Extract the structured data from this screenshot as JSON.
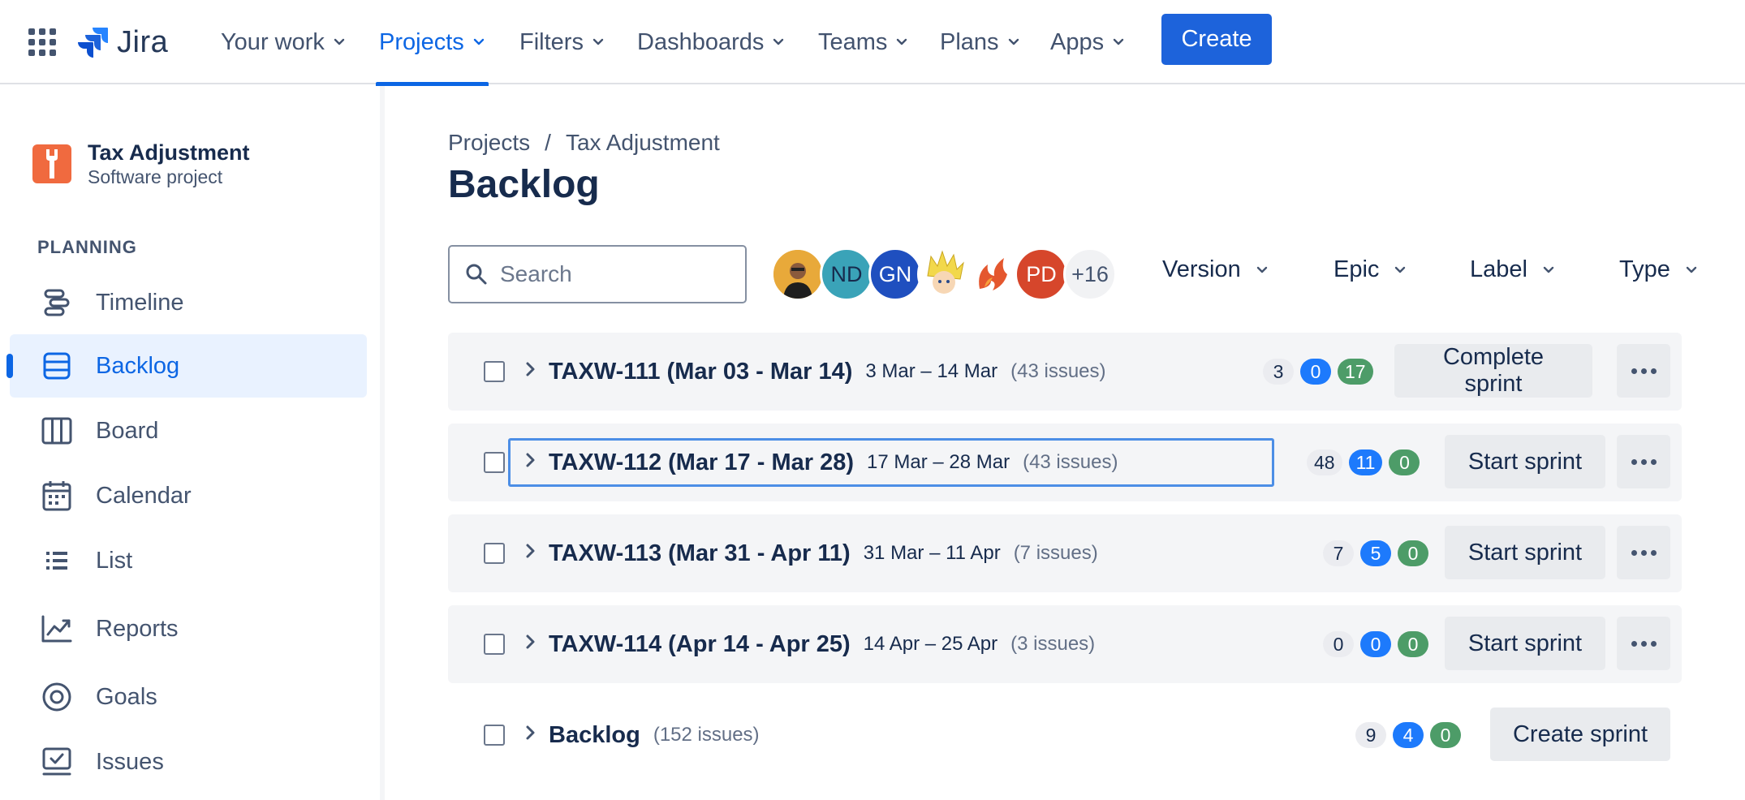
{
  "topnav": {
    "logo_text": "Jira",
    "items": [
      {
        "label": "Your work"
      },
      {
        "label": "Projects",
        "active": true
      },
      {
        "label": "Filters"
      },
      {
        "label": "Dashboards"
      },
      {
        "label": "Teams"
      },
      {
        "label": "Plans"
      },
      {
        "label": "Apps"
      }
    ],
    "create_label": "Create"
  },
  "sidebar": {
    "project_name": "Tax Adjustment",
    "project_type": "Software project",
    "section_label": "PLANNING",
    "items": [
      {
        "label": "Timeline",
        "icon": "timeline-icon"
      },
      {
        "label": "Backlog",
        "icon": "backlog-icon",
        "active": true
      },
      {
        "label": "Board",
        "icon": "board-icon"
      },
      {
        "label": "Calendar",
        "icon": "calendar-icon"
      },
      {
        "label": "List",
        "icon": "list-icon"
      },
      {
        "label": "Reports",
        "icon": "reports-icon"
      },
      {
        "label": "Goals",
        "icon": "goals-icon"
      },
      {
        "label": "Issues",
        "icon": "issues-icon"
      }
    ]
  },
  "breadcrumb": {
    "root": "Projects",
    "separator": "/",
    "current": "Tax Adjustment"
  },
  "page_title": "Backlog",
  "search": {
    "placeholder": "Search",
    "value": ""
  },
  "avatars": {
    "items": [
      {
        "initials": "",
        "kind": "photo",
        "color": "#e8a93a"
      },
      {
        "initials": "ND",
        "color": "#3aa3b8"
      },
      {
        "initials": "GN",
        "color": "#1f4fbf"
      },
      {
        "initials": "",
        "kind": "cartoon",
        "color": "#f2d84b"
      },
      {
        "initials": "",
        "kind": "phoenix",
        "color": "#e4572e"
      },
      {
        "initials": "PD",
        "color": "#d6462b"
      }
    ],
    "overflow": "+16"
  },
  "filters": {
    "version": "Version",
    "epic": "Epic",
    "label": "Label",
    "type": "Type"
  },
  "sprints": [
    {
      "name": "TAXW-111 (Mar 03 - Mar 14)",
      "dates": "3 Mar – 14 Mar",
      "count": "(43 issues)",
      "todo": "3",
      "in_progress": "0",
      "done": "17",
      "action": "Complete sprint"
    },
    {
      "name": "TAXW-112 (Mar 17 - Mar 28)",
      "dates": "17 Mar – 28 Mar",
      "count": "(43 issues)",
      "todo": "48",
      "in_progress": "11",
      "done": "0",
      "action": "Start sprint"
    },
    {
      "name": "TAXW-113 (Mar 31 - Apr 11)",
      "dates": "31 Mar – 11 Apr",
      "count": "(7 issues)",
      "todo": "7",
      "in_progress": "5",
      "done": "0",
      "action": "Start sprint"
    },
    {
      "name": "TAXW-114 (Apr 14 - Apr 25)",
      "dates": "14 Apr – 25 Apr",
      "count": "(3 issues)",
      "todo": "0",
      "in_progress": "0",
      "done": "0",
      "action": "Start sprint"
    }
  ],
  "backlog": {
    "name": "Backlog",
    "count": "(152 issues)",
    "todo": "9",
    "in_progress": "4",
    "done": "0",
    "action": "Create sprint"
  },
  "colors": {
    "accent": "#0c66e4",
    "create_button": "#1d63db",
    "lozenge_blue": "#1d7afc",
    "lozenge_green": "#4d9c68"
  }
}
